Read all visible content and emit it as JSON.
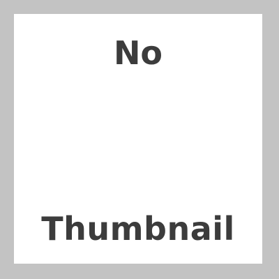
{
  "placeholder": {
    "line1": "No",
    "line2": "Thumbnail"
  },
  "colors": {
    "border": "#c3c3c3",
    "panel": "#ffffff",
    "text": "#3c3c3c"
  }
}
